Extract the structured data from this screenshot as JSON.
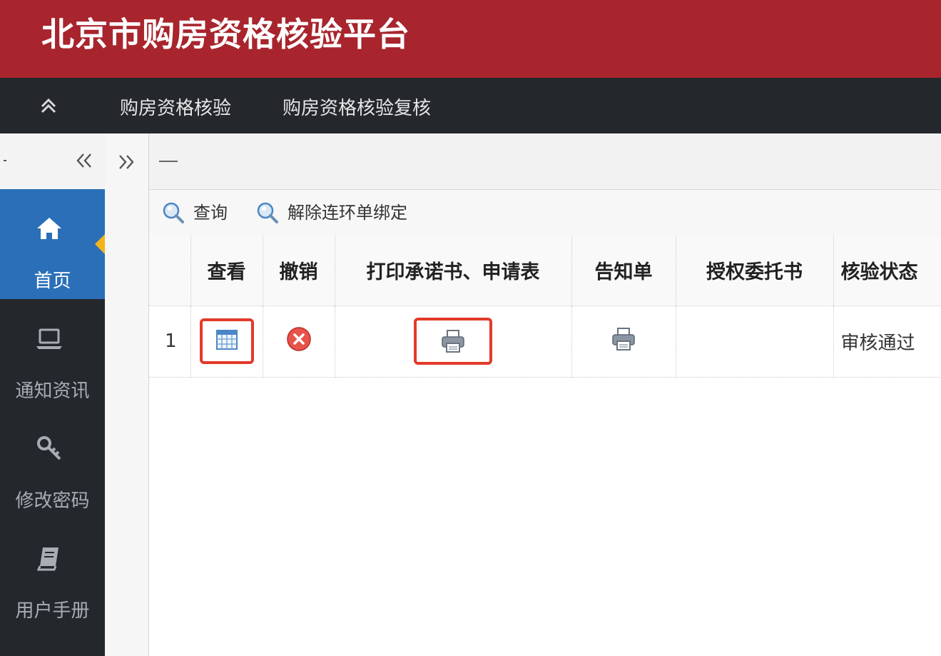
{
  "app": {
    "title": "北京市购房资格核验平台"
  },
  "nav": {
    "collapse_icon": "double-chevron-up-icon",
    "items": [
      {
        "label": "购房资格核验"
      },
      {
        "label": "购房资格核验复核"
      }
    ]
  },
  "sidebar": {
    "collapse_icon": "double-chevron-left-icon",
    "items": [
      {
        "label": "首页",
        "icon": "home-icon",
        "active": true
      },
      {
        "label": "通知资讯",
        "icon": "laptop-icon",
        "active": false
      },
      {
        "label": "修改密码",
        "icon": "key-icon",
        "active": false
      },
      {
        "label": "用户手册",
        "icon": "book-icon",
        "active": false
      }
    ]
  },
  "splitter": {
    "expand_icon": "double-chevron-right-icon"
  },
  "toolbar": {
    "buttons": [
      {
        "label": "查询",
        "icon": "search-icon"
      },
      {
        "label": "解除连环单绑定",
        "icon": "search-icon"
      }
    ]
  },
  "grid": {
    "columns": [
      "",
      "查看",
      "撤销",
      "打印承诺书、申请表",
      "告知单",
      "授权委托书",
      "核验状态"
    ],
    "rows": [
      {
        "num": "1",
        "view_icon": "table-view-icon",
        "cancel_icon": "cancel-x-icon",
        "print_icon": "printer-icon",
        "notice_icon": "printer-icon",
        "authorization": "",
        "status": "审核通过"
      }
    ]
  },
  "colors": {
    "title_bar": "#a8252d",
    "nav_bar": "#24272c",
    "active_sidebar": "#2a6fb8",
    "highlight": "#e23a2a",
    "pointer": "#f3b51b"
  }
}
